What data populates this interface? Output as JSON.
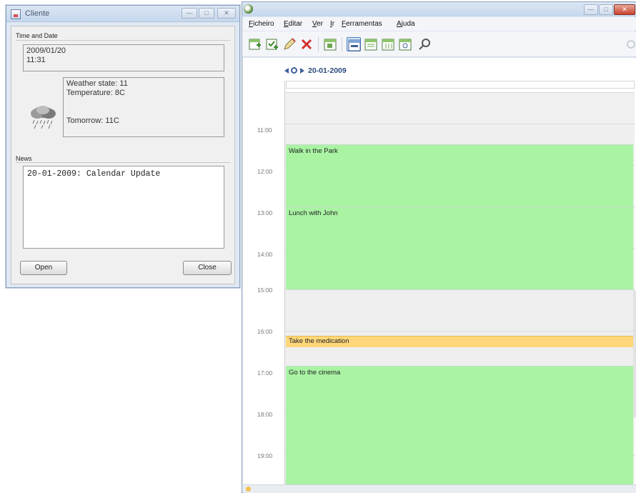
{
  "client_window": {
    "title": "Cliente",
    "controls": {
      "minimize": "—",
      "maximize": "□",
      "close": "✕"
    },
    "time_date": {
      "label": "Time and Date",
      "date": "2009/01/20",
      "time": "11:31"
    },
    "weather": {
      "icon": "rain-cloud-icon",
      "state": "Weather state: 11",
      "temperature": "Temperature: 8C",
      "tomorrow": "Tomorrow: 11C"
    },
    "news": {
      "label": "News",
      "items": [
        "20-01-2009: Calendar Update"
      ]
    },
    "buttons": {
      "open": "Open",
      "close": "Close"
    }
  },
  "calendar_window": {
    "controls": {
      "minimize": "—",
      "maximize": "□",
      "close": "✕"
    },
    "menu": [
      "Ficheiro",
      "Editar",
      "Ver",
      "Ir",
      "Ferramentas",
      "Ajuda"
    ],
    "toolbar_icons": [
      "new-event-icon",
      "new-task-icon",
      "edit-pencil-icon",
      "delete-icon",
      "go-today-icon",
      "day-view-icon",
      "week-view-icon",
      "workweek-view-icon",
      "month-view-icon",
      "search-icon"
    ],
    "current_date": "20-01-2009",
    "hours": [
      "11:00",
      "12:00",
      "13:00",
      "14:00",
      "15:00",
      "16:00",
      "17:00",
      "18:00",
      "19:00"
    ],
    "events": [
      {
        "title": "Walk in the Park",
        "color": "#a9f3a3",
        "start": "11:30",
        "end": "13:00"
      },
      {
        "title": "Lunch with John",
        "color": "#a9f3a3",
        "start": "13:00",
        "end": "15:00"
      },
      {
        "title": "Take the medication",
        "color": "#ffd77a",
        "start": "16:15",
        "end": "16:30"
      },
      {
        "title": "Go to the cinema",
        "color": "#a9f3a3",
        "start": "17:00",
        "end": "20:00"
      }
    ]
  }
}
